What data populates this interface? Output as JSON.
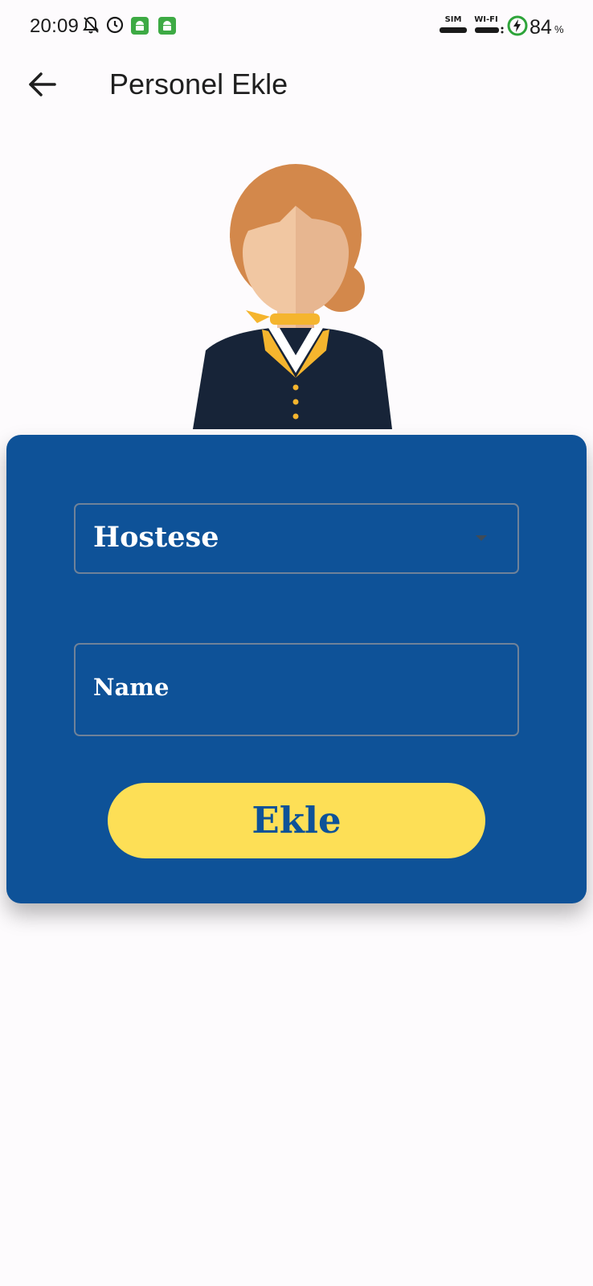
{
  "status_bar": {
    "time": "20:09",
    "sim_label": "SIM",
    "wifi_label": "WI-FI",
    "battery_percent": "84",
    "battery_sign": "%",
    "icons": [
      "bell-off-icon",
      "alarm-icon",
      "android-app-icon",
      "android-app-icon",
      "sim-signal-icon",
      "wifi-signal-icon",
      "battery-charging-icon"
    ]
  },
  "app_bar": {
    "title": "Personel Ekle",
    "back_icon": "arrow-left-icon"
  },
  "form": {
    "role_dropdown": {
      "selected": "Hostese",
      "icon": "dropdown-arrow-icon"
    },
    "name_field": {
      "label": "Name",
      "value": ""
    },
    "submit_label": "Ekle"
  },
  "colors": {
    "background": "#fdfbfd",
    "card": "#0e5298",
    "button": "#fddf56",
    "button_text": "#0e5298",
    "field_border": "#6f8299",
    "app_icon": "#3daa44"
  }
}
